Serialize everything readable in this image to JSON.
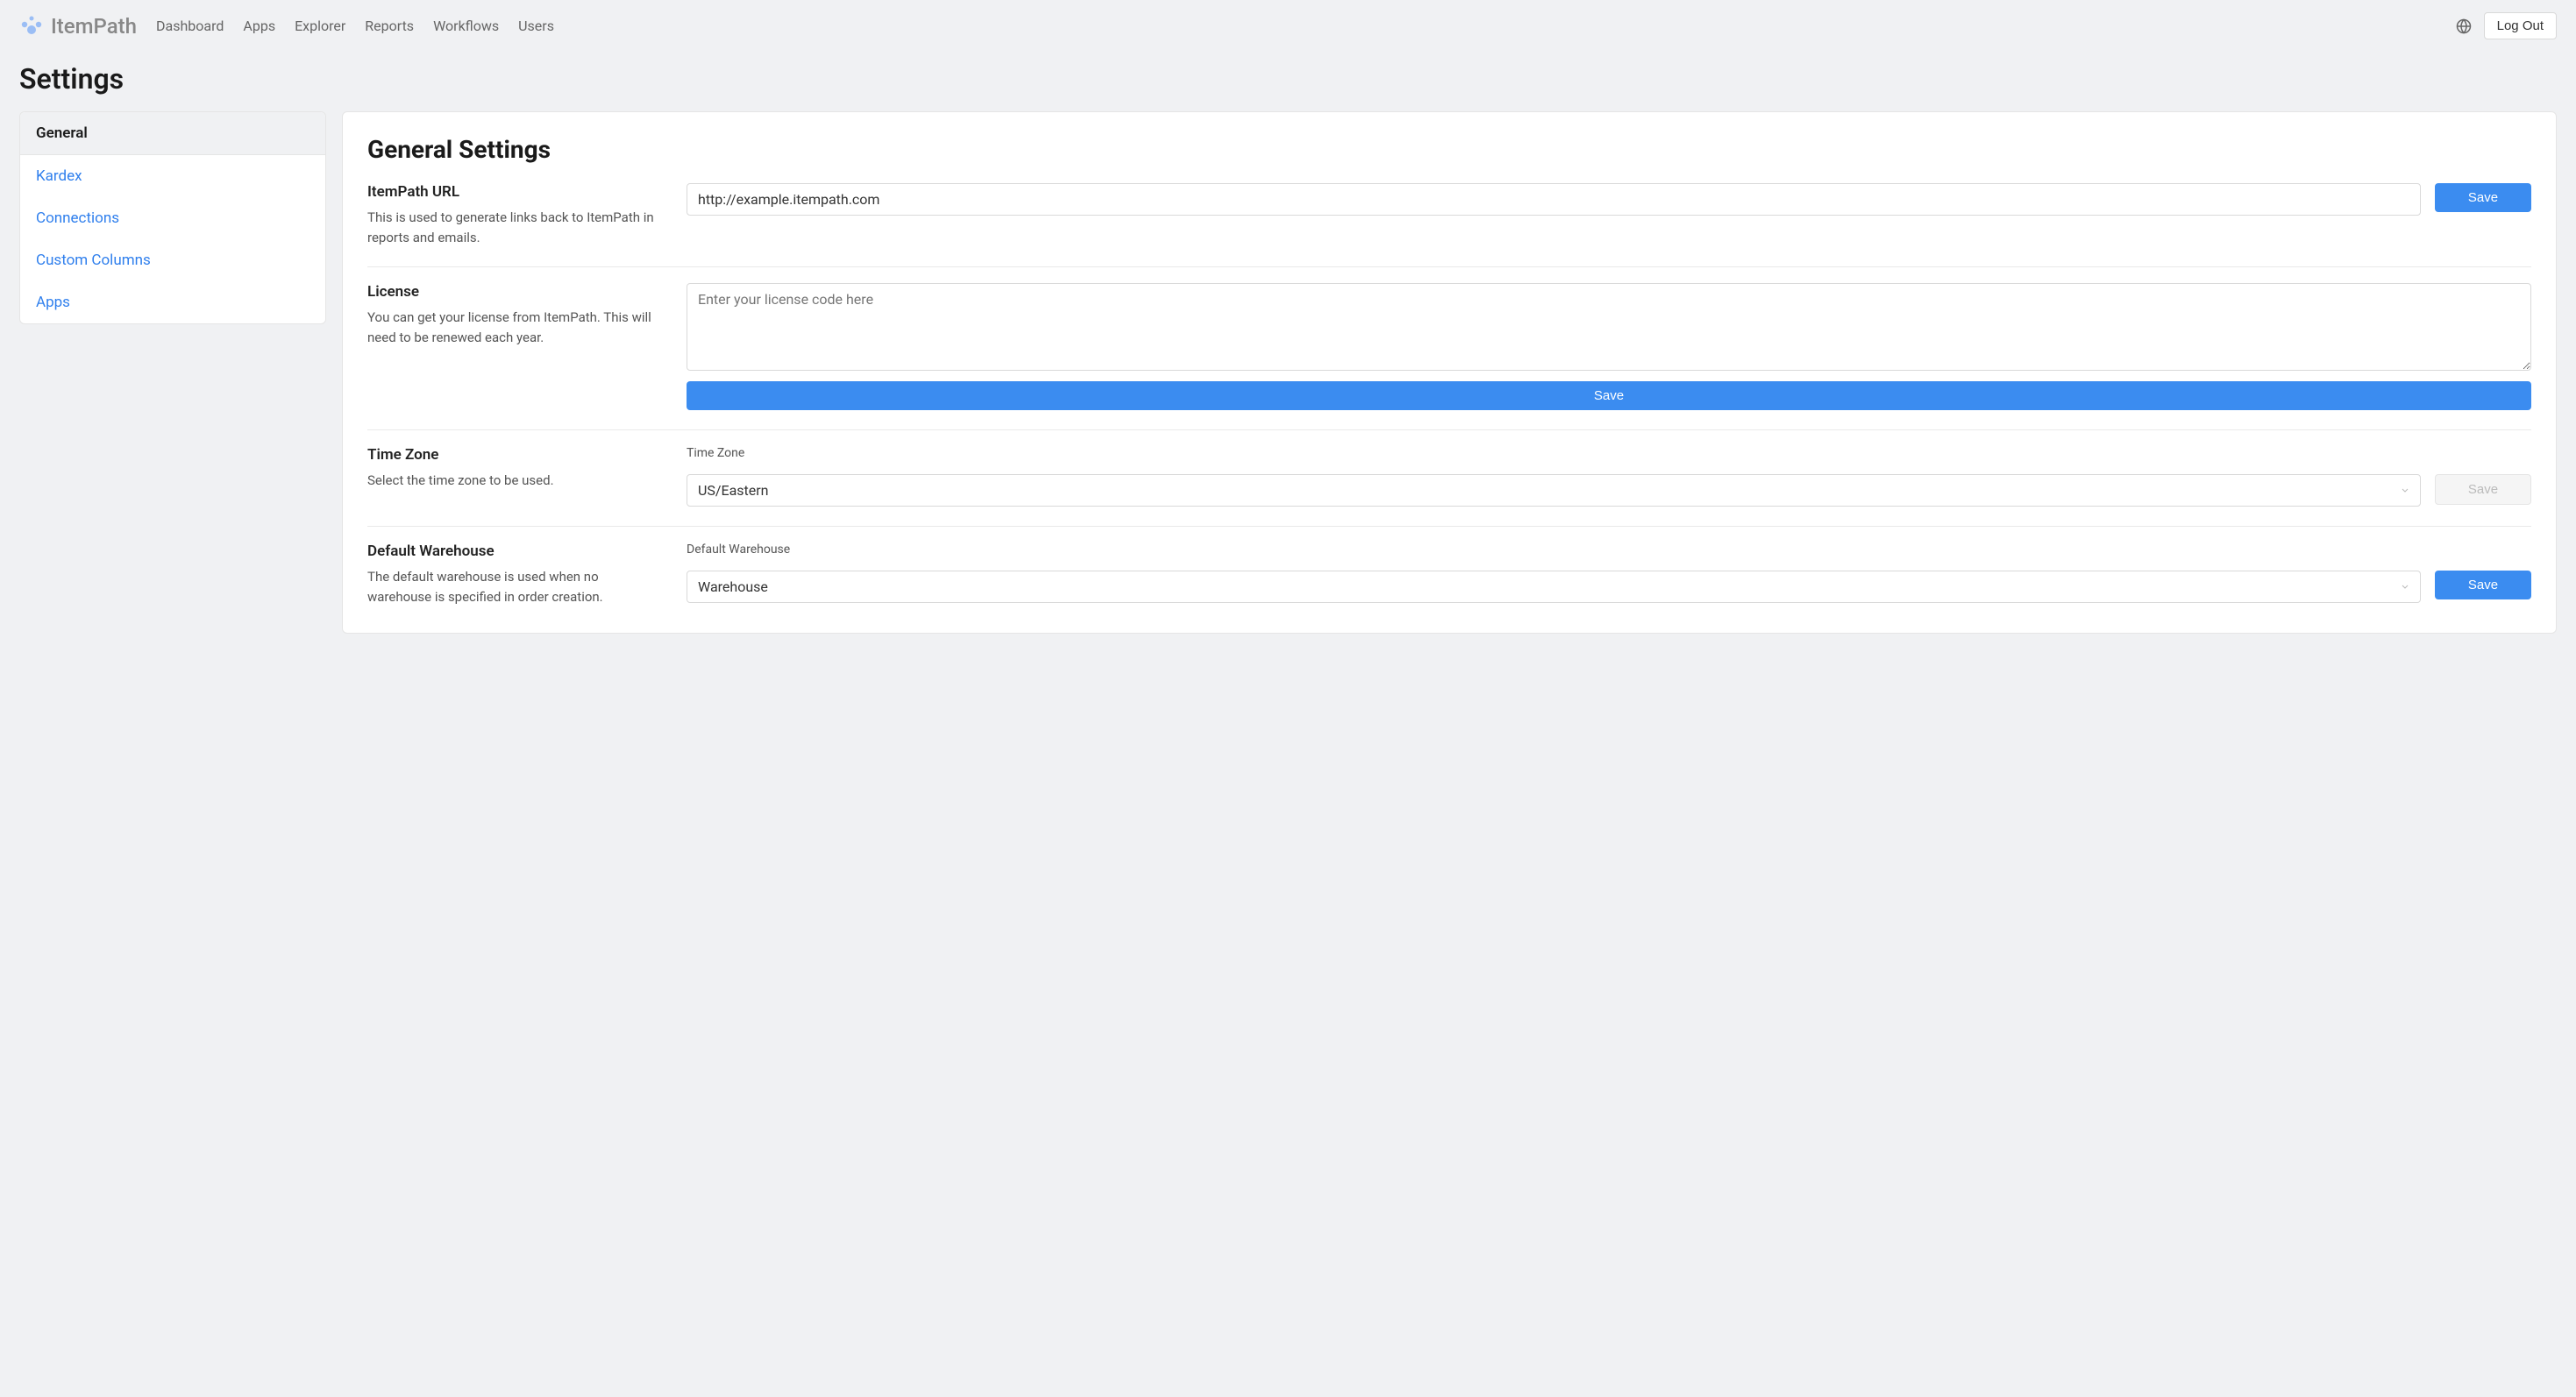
{
  "brand": {
    "name": "ItemPath"
  },
  "nav": {
    "items": [
      {
        "label": "Dashboard"
      },
      {
        "label": "Apps"
      },
      {
        "label": "Explorer"
      },
      {
        "label": "Reports"
      },
      {
        "label": "Workflows"
      },
      {
        "label": "Users"
      }
    ]
  },
  "topbar": {
    "logout": "Log Out"
  },
  "page": {
    "title": "Settings"
  },
  "sidebar": {
    "items": [
      {
        "label": "General"
      },
      {
        "label": "Kardex"
      },
      {
        "label": "Connections"
      },
      {
        "label": "Custom Columns"
      },
      {
        "label": "Apps"
      }
    ]
  },
  "content": {
    "title": "General Settings",
    "itempath_url": {
      "label": "ItemPath URL",
      "description": "This is used to generate links back to ItemPath in reports and emails.",
      "value": "http://example.itempath.com",
      "save": "Save"
    },
    "license": {
      "label": "License",
      "description": "You can get your license from ItemPath. This will need to be renewed each year.",
      "placeholder": "Enter your license code here",
      "save": "Save"
    },
    "timezone": {
      "label": "Time Zone",
      "description": "Select the time zone to be used.",
      "sublabel": "Time Zone",
      "value": "US/Eastern",
      "save": "Save"
    },
    "warehouse": {
      "label": "Default Warehouse",
      "description": "The default warehouse is used when no warehouse is specified in order creation.",
      "sublabel": "Default Warehouse",
      "value": "Warehouse",
      "save": "Save"
    }
  }
}
